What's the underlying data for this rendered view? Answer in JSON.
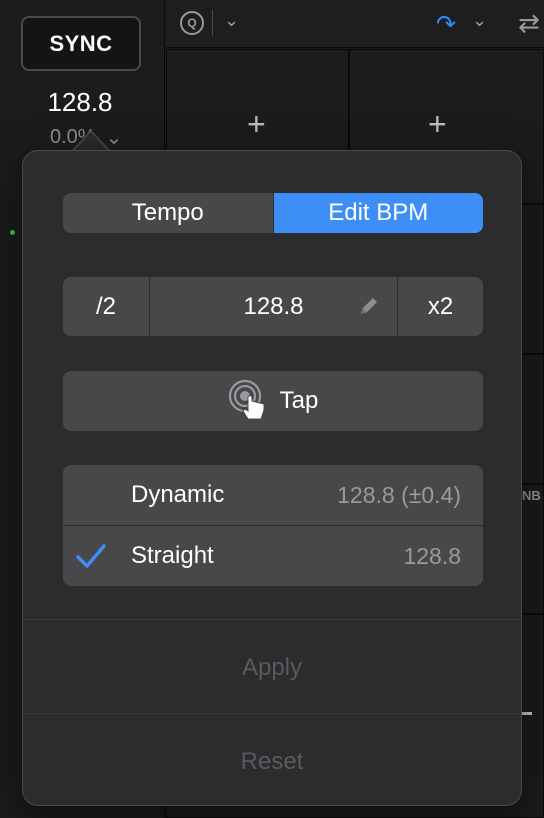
{
  "background": {
    "sync_label": "SYNC",
    "tempo": "128.8",
    "pitch": "0.0%",
    "nb_text": "NB",
    "top_icons": [
      "q-icon",
      "chevron-down-icon",
      "redo-icon",
      "chevron-down-icon",
      "loop-icon"
    ],
    "plus_symbol": "+"
  },
  "popover": {
    "tabs": [
      {
        "label": "Tempo",
        "active": false
      },
      {
        "label": "Edit BPM",
        "active": true
      }
    ],
    "bpm": {
      "halve_label": "/2",
      "value": "128.8",
      "double_label": "x2",
      "edit_icon": "pencil-icon"
    },
    "tap": {
      "label": "Tap",
      "icon": "tap-touch-icon"
    },
    "modes": [
      {
        "label": "Dynamic",
        "value": "128.8 (±0.4)",
        "checked": false
      },
      {
        "label": "Straight",
        "value": "128.8",
        "checked": true
      }
    ],
    "apply_label": "Apply",
    "reset_label": "Reset"
  },
  "colors": {
    "accent": "#3d8ef7",
    "control_bg": "#48484a",
    "popover_bg": "#2c2c2e",
    "disabled_text": "#5a5a5e",
    "indicator_green": "#32d74b"
  }
}
